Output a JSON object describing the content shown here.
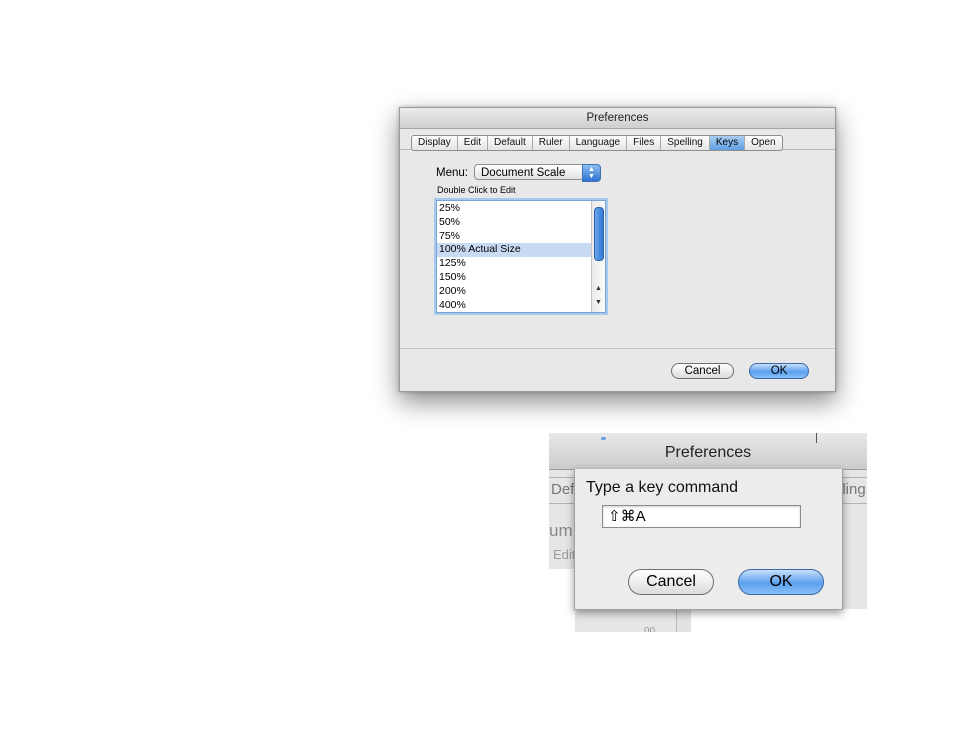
{
  "main_window": {
    "title": "Preferences",
    "tabs": [
      "Display",
      "Edit",
      "Default",
      "Ruler",
      "Language",
      "Files",
      "Spelling",
      "Keys",
      "Open"
    ],
    "active_tab": "Keys",
    "menu_label": "Menu:",
    "menu_value": "Document Scale",
    "hint": "Double Click to Edit",
    "list_items": [
      "25%",
      "50%",
      "75%",
      "100% Actual Size",
      "125%",
      "150%",
      "200%",
      "400%"
    ],
    "selected_item": "100% Actual Size",
    "cancel_label": "Cancel",
    "ok_label": "OK"
  },
  "key_sheet": {
    "title": "Preferences",
    "prompt": "Type a key command",
    "key_value": "⇧⌘A",
    "cancel_label": "Cancel",
    "ok_label": "OK",
    "background_fragments": {
      "tab_left": "Def",
      "tab_right": "lling",
      "menu_fragment": "um",
      "edit_fragment": "Edit",
      "bottom_fragment": "00"
    }
  },
  "colors": {
    "accent_blue": "#5ba0ef",
    "selection": "#c9dbf3",
    "window_bg": "#e8e8e8"
  }
}
